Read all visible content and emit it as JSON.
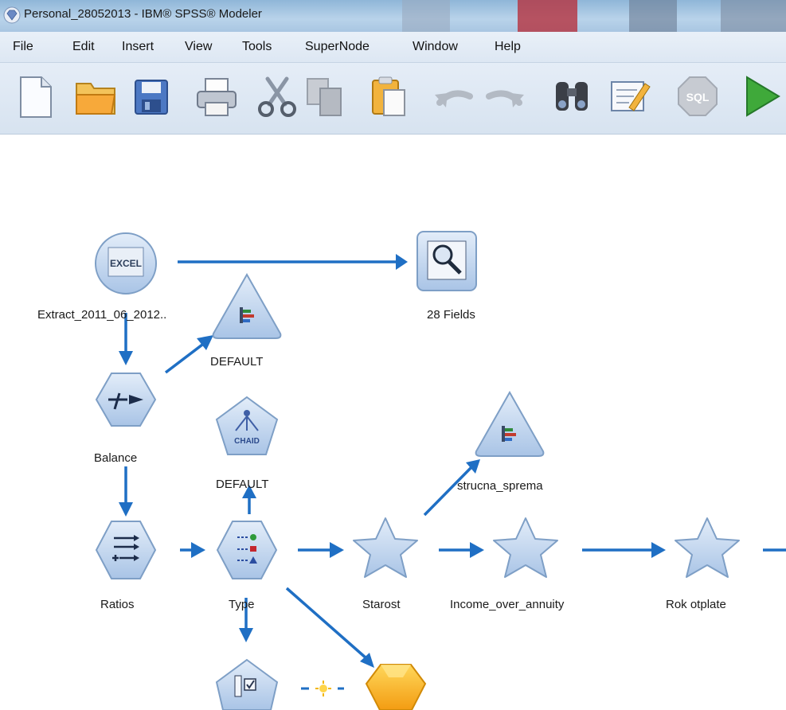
{
  "window": {
    "title": "Personal_28052013 - IBM® SPSS® Modeler"
  },
  "menu": [
    {
      "label": "File"
    },
    {
      "label": "Edit"
    },
    {
      "label": "Insert"
    },
    {
      "label": "View"
    },
    {
      "label": "Tools"
    },
    {
      "label": "SuperNode"
    },
    {
      "label": "Window"
    },
    {
      "label": "Help"
    }
  ],
  "toolbar": {
    "icons": [
      "new-file-icon",
      "open-folder-icon",
      "save-icon",
      "print-icon",
      "cut-icon",
      "copy-icon",
      "paste-icon",
      "undo-icon",
      "redo-icon",
      "find-icon",
      "annotate-icon",
      "sql-icon",
      "run-icon"
    ],
    "sql_text": "SQL"
  },
  "nodes": {
    "excel": {
      "label": "Extract_2011_06_2012..",
      "badge": "EXCEL"
    },
    "table": {
      "label": "28 Fields"
    },
    "graph_default": {
      "label": "DEFAULT"
    },
    "balance": {
      "label": "Balance"
    },
    "chaid": {
      "label": "DEFAULT",
      "badge": "CHAID"
    },
    "graph_strucna": {
      "label": "strucna_sprema"
    },
    "ratios": {
      "label": "Ratios"
    },
    "type": {
      "label": "Type"
    },
    "starost": {
      "label": "Starost"
    },
    "income": {
      "label": "Income_over_annuity"
    },
    "rok": {
      "label": "Rok otplate"
    }
  },
  "colors": {
    "arrow": "#1f6fc4",
    "node_fill": "#b8cfe9",
    "node_stroke": "#7e9fc6",
    "model_gold": "#f6b41a"
  }
}
